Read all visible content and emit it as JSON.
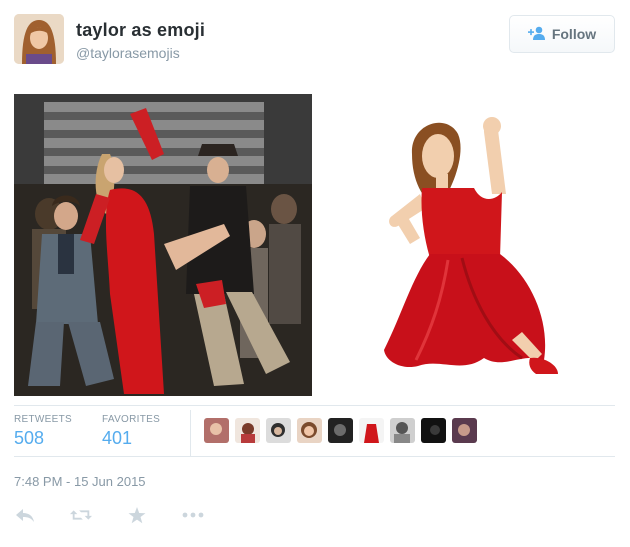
{
  "tweet": {
    "display_name": "taylor as emoji",
    "handle": "@taylorasemojis",
    "follow_label": "Follow",
    "emoji_name": "dancer"
  },
  "stats": {
    "retweets_label": "RETWEETS",
    "retweets_count": "508",
    "favorites_label": "FAVORITES",
    "favorites_count": "401"
  },
  "favoriter_avatars": [
    "user-avatar-1",
    "user-avatar-2",
    "user-avatar-3",
    "user-avatar-4",
    "user-avatar-5",
    "user-avatar-6",
    "user-avatar-7",
    "user-avatar-8",
    "user-avatar-9"
  ],
  "timestamp": "7:48 PM - 15 Jun 2015",
  "actions": [
    "reply-icon",
    "retweet-icon",
    "favorite-icon",
    "more-icon"
  ],
  "colors": {
    "link_blue": "#55acee",
    "muted": "#8899a6",
    "dress_red": "#d0161b",
    "divider": "#e1e8ed"
  }
}
